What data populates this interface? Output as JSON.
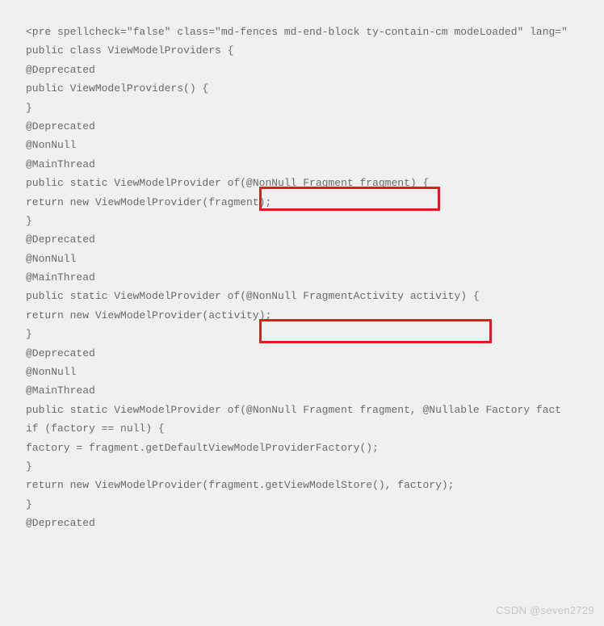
{
  "code": {
    "l1": "<pre spellcheck=\"false\" class=\"md-fences md-end-block ty-contain-cm modeLoaded\" lang=\"",
    "l2": "public class ViewModelProviders {",
    "l3": "@Deprecated",
    "l4": "public ViewModelProviders() {",
    "l5": "}",
    "l6": "",
    "l7": "@Deprecated",
    "l8": "@NonNull",
    "l9": "@MainThread",
    "l10": "public static ViewModelProvider of(@NonNull Fragment fragment) {",
    "l11": "return new ViewModelProvider(fragment);",
    "l12": "}",
    "l13": "",
    "l14": "@Deprecated",
    "l15": "@NonNull",
    "l16": "@MainThread",
    "l17": "public static ViewModelProvider of(@NonNull FragmentActivity activity) {",
    "l18": "return new ViewModelProvider(activity);",
    "l19": "}",
    "l20": "",
    "l21": "@Deprecated",
    "l22": "@NonNull",
    "l23": "@MainThread",
    "l24": "public static ViewModelProvider of(@NonNull Fragment fragment, @Nullable Factory fact",
    "l25": "if (factory == null) {",
    "l26": "factory = fragment.getDefaultViewModelProviderFactory();",
    "l27": "}",
    "l28": "return new ViewModelProvider(fragment.getViewModelStore(), factory);",
    "l29": "}",
    "l30": "",
    "l31": "",
    "l32": "@Deprecated"
  },
  "highlights": {
    "box1_colors": {
      "border": "#e11c1c"
    },
    "box2_colors": {
      "border": "#e11c1c"
    }
  },
  "watermark": "CSDN @seven2729"
}
